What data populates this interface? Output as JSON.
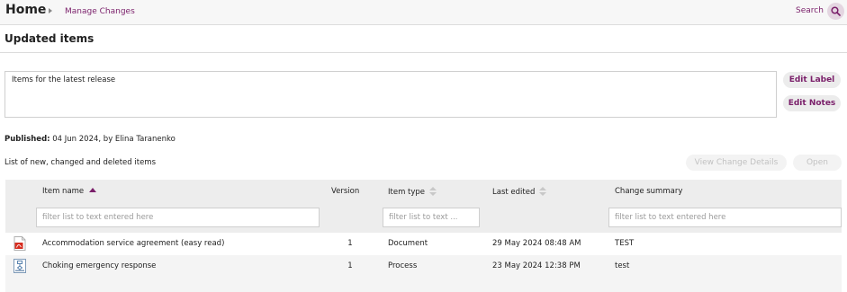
{
  "header": {
    "home": "Home",
    "breadcrumb": "Manage Changes",
    "search_label": "Search"
  },
  "page": {
    "title": "Updated items"
  },
  "notes": {
    "text": "Items for the latest release"
  },
  "buttons": {
    "edit_label": "Edit Label",
    "edit_notes": "Edit Notes",
    "view_change_details": "View Change Details",
    "open": "Open"
  },
  "published": {
    "label": "Published:",
    "value": " 04 Jun 2024, by Elina Taranenko"
  },
  "list_caption": "List of new, changed and deleted items",
  "table": {
    "columns": {
      "item_name": "Item name",
      "version": "Version",
      "item_type": "Item type",
      "last_edited": "Last edited",
      "change_summary": "Change summary"
    },
    "filters": {
      "item_name": "filter list to text entered here",
      "item_type": "filter list to text ...",
      "change_summary": "filter list to text entered here"
    },
    "sort": {
      "item_name": "ascending"
    },
    "rows": [
      {
        "icon": "pdf-document-icon",
        "name": "Accommodation service agreement (easy read)",
        "version": "1",
        "type": "Document",
        "last_edited": "29 May 2024 08:48 AM",
        "summary": "TEST"
      },
      {
        "icon": "process-diagram-icon",
        "name": "Choking emergency response",
        "version": "1",
        "type": "Process",
        "last_edited": "23 May 2024 12:38 PM",
        "summary": "test"
      }
    ]
  },
  "colors": {
    "accent": "#7a1f6a",
    "header_bg": "#f7f7f7",
    "table_header_bg": "#ededed",
    "disabled_text": "#c2c2c2"
  }
}
